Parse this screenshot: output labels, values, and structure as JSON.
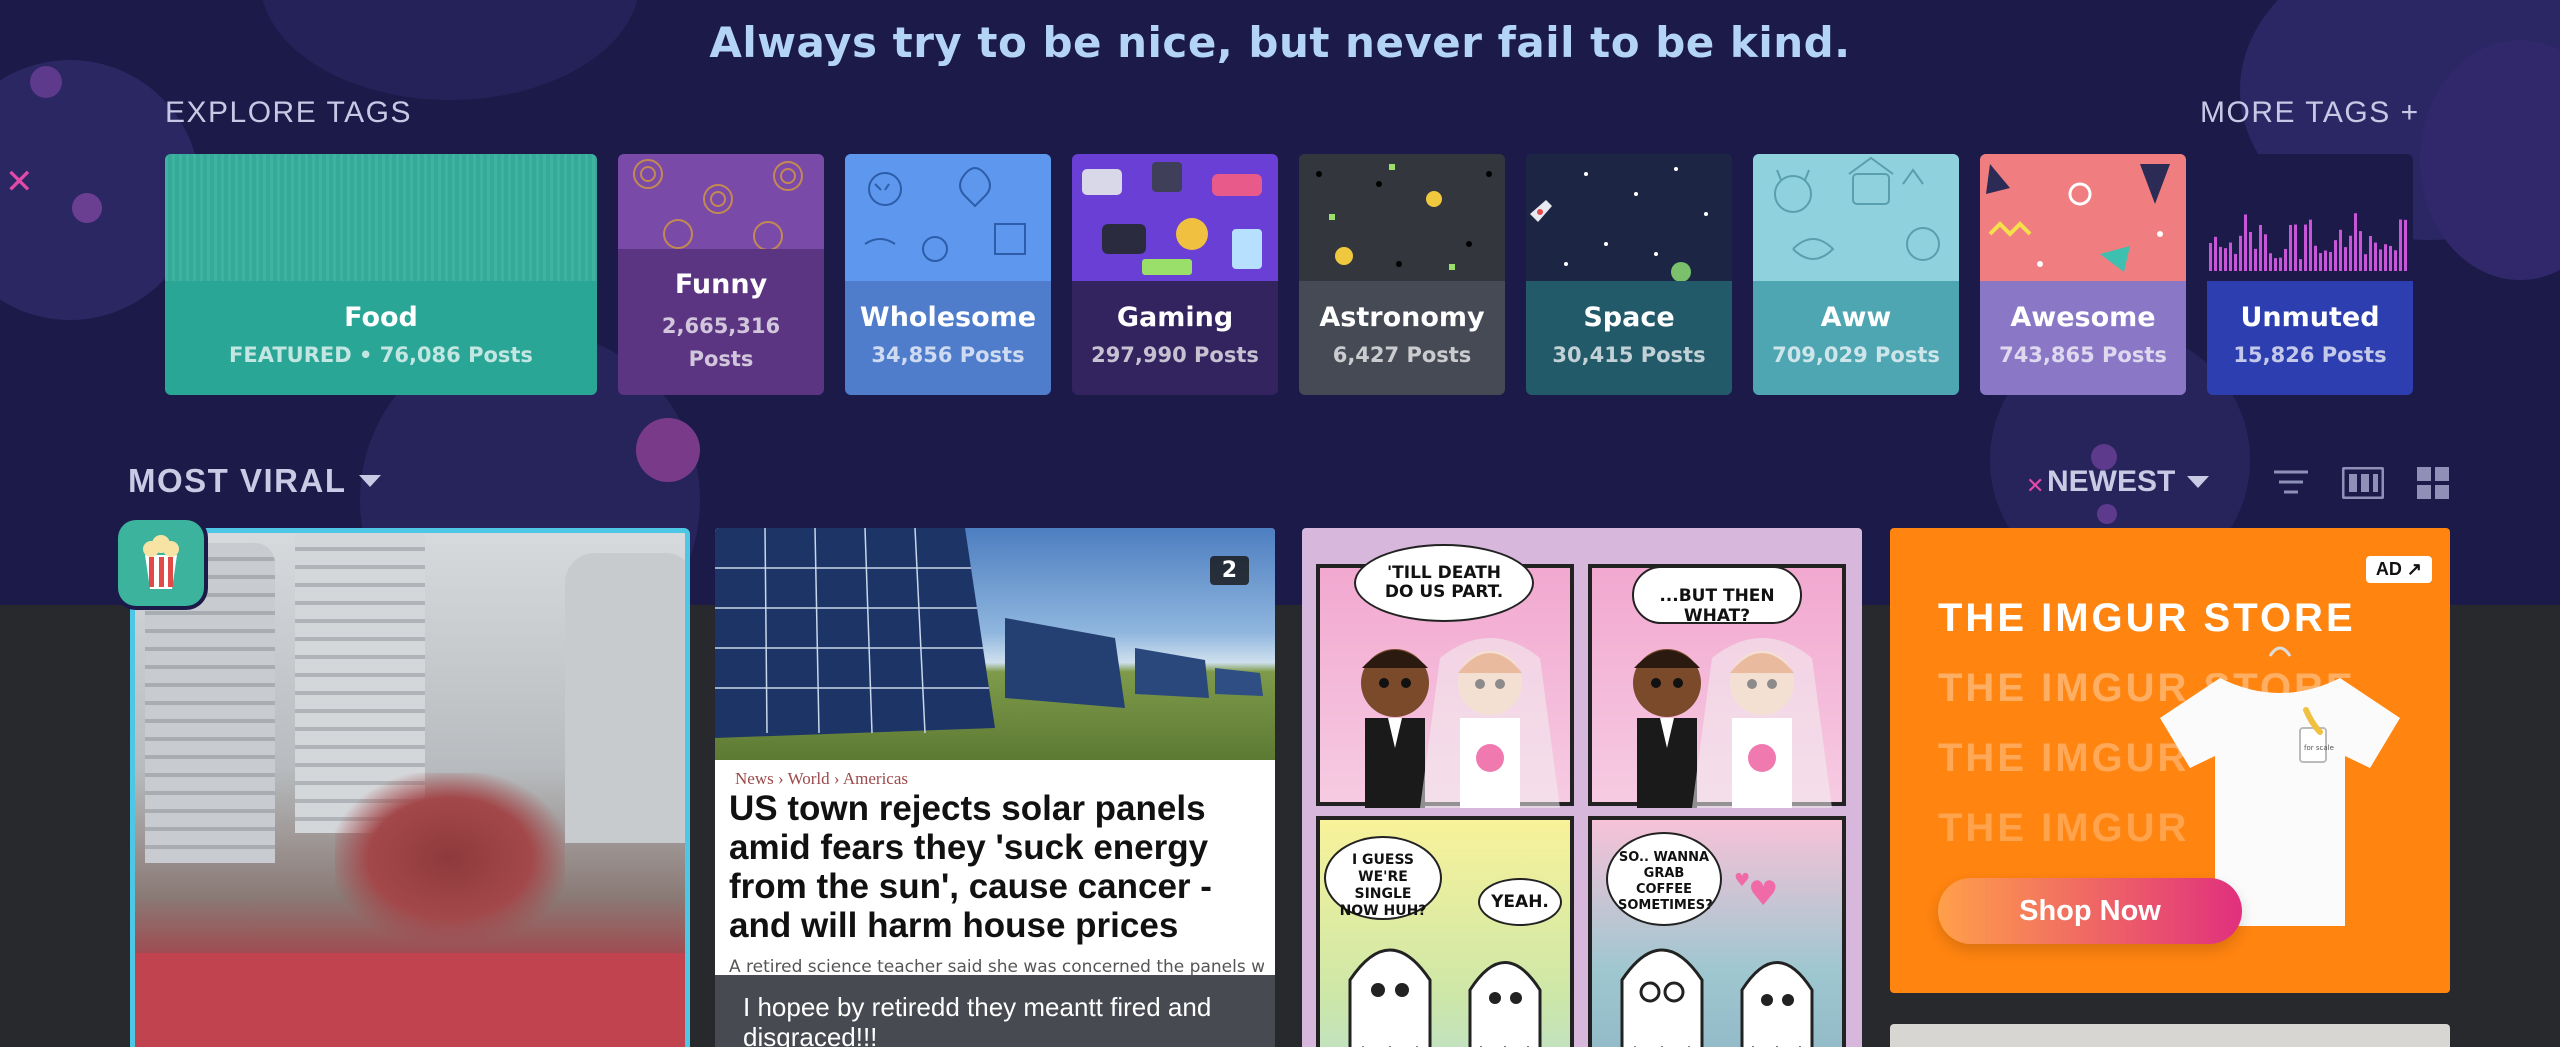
{
  "quote": "Always try to be nice, but never fail to be kind.",
  "explore": {
    "label": "EXPLORE TAGS",
    "more_label": "MORE TAGS +"
  },
  "tags": [
    {
      "name": "Food",
      "count": "FEATURED • 76,086 Posts",
      "color": "#2aa696"
    },
    {
      "name": "Funny",
      "count": "2,665,316 Posts",
      "count_line1": "2,665,316",
      "count_line2": "Posts",
      "color": "#6c3d93"
    },
    {
      "name": "Wholesome",
      "count": "34,856 Posts",
      "color": "#4f7dcc"
    },
    {
      "name": "Gaming",
      "count": "297,990 Posts",
      "color": "#3b2a74"
    },
    {
      "name": "Astronomy",
      "count": "6,427 Posts",
      "color": "#464a54"
    },
    {
      "name": "Space",
      "count": "30,415 Posts",
      "color": "#235a6a"
    },
    {
      "name": "Aww",
      "count": "709,029 Posts",
      "color": "#4fa6b3"
    },
    {
      "name": "Awesome",
      "count": "743,865 Posts",
      "color": "#8a78c7"
    },
    {
      "name": "Unmuted",
      "count": "15,826 Posts",
      "color": "#2d3fb0"
    }
  ],
  "feed": {
    "section_label": "MOST VIRAL",
    "sort_label": "NEWEST"
  },
  "posts": [
    {
      "type": "video"
    },
    {
      "image_count": "2",
      "breadcrumb": "News › World › Americas",
      "headline": "US town rejects solar panels amid fears they 'suck energy from the sun', cause cancer - and will harm house prices",
      "subtext": "A retired science teacher said she was concerned the panels would",
      "caption": "I hopee by retiredd they meantt fired and disgraced!!!"
    },
    {
      "panels": [
        "'TILL DEATH DO US PART.",
        "...BUT THEN WHAT?",
        "I GUESS WE'RE SINGLE NOW HUH?",
        "YEAH.",
        "SO.. WANNA GRAB COFFEE SOMETIMES?"
      ]
    },
    {
      "ad_badge": "AD",
      "store_lines": [
        "THE IMGUR STORE",
        "THE IMGUR STORE",
        "THE IMGUR",
        "THE IMGUR"
      ],
      "shop_label": "Shop Now",
      "shirt_tag": "for scale"
    }
  ],
  "colors": {
    "hero_bg": "#1b1a49",
    "page_bg": "#27292d",
    "store_orange": "#ff8410",
    "accent_pink": "#e24aa8"
  }
}
